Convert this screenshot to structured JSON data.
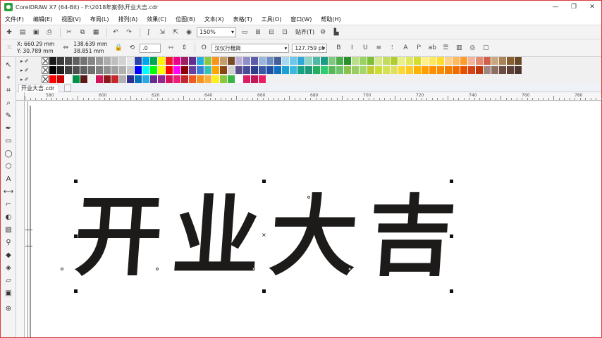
{
  "window": {
    "title": "CorelDRAW X7 (64-Bit) - F:\\2018年案例\\开业大吉.cdr",
    "controls": [
      "—",
      "❐",
      "✕"
    ]
  },
  "menu": [
    "文件(F)",
    "编辑(E)",
    "视图(V)",
    "布局(L)",
    "排列(A)",
    "效果(C)",
    "位图(B)",
    "文本(X)",
    "表格(T)",
    "工具(O)",
    "窗口(W)",
    "帮助(H)"
  ],
  "toolbar": {
    "zoom": "150%",
    "snap": "贴齐(T)"
  },
  "properties": {
    "x": "X: 660.29 mm",
    "y": "Y: 30.789 mm",
    "width": "138.639 mm",
    "height": "38.851 mm",
    "rotation": ".0",
    "font": "汉仪行楷简",
    "font_size": "127.759 pt"
  },
  "palettes": [
    [
      "#1b1b1b",
      "#3a3a3a",
      "#4d4d4d",
      "#606060",
      "#737373",
      "#868686",
      "#999999",
      "#acacac",
      "#bfbfbf",
      "#d2d2d2",
      "#e5e5e5",
      "#2c44a8",
      "#00a7e8",
      "#00a651",
      "#fff200",
      "#ed1c24",
      "#ec008c",
      "#9e1f63",
      "#662d91",
      "#29abe2",
      "#8dc63f",
      "#f7941d",
      "#c69c6d",
      "#754c24",
      "#bdb0d8",
      "#8f8fc8",
      "#5c5caa",
      "#9ab4da",
      "#6e8ec2",
      "#445f99",
      "#a8d8f0",
      "#6ec6e8",
      "#2fa8d8",
      "#8ed3c3",
      "#4fb9a7",
      "#1a9b85",
      "#7fc97f",
      "#4dad4d",
      "#2b8f2b",
      "#b8e08a",
      "#9ad25f",
      "#7bbf3a",
      "#d6e88a",
      "#c4dc5e",
      "#b0cc2e",
      "#eaf08a",
      "#e0e85e",
      "#d4dc2e",
      "#fff08a",
      "#ffe85e",
      "#ffdc2e",
      "#ffd08a",
      "#ffb85e",
      "#ff9c2e",
      "#f0b4a0",
      "#e48c74",
      "#d0604a",
      "#c8a880",
      "#a88458",
      "#886030",
      "#6a4a26"
    ],
    [
      "#000000",
      "#202020",
      "#404040",
      "#505050",
      "#606060",
      "#707070",
      "#808080",
      "#909090",
      "#a0a0a0",
      "#b0b0b0",
      "#c8c8c8",
      "#0000ff",
      "#00ffff",
      "#00ff00",
      "#ffff00",
      "#ff0000",
      "#ff00ff",
      "#8b0000",
      "#6b3fa0",
      "#3d7edb",
      "#36c2b4",
      "#ffa500",
      "#8b4513",
      "#d3d3d3",
      "#5a4e8c",
      "#4a4a9a",
      "#2c3e8c",
      "#3a5aa8",
      "#1e4fa0",
      "#0f6fc0",
      "#1ea0d0",
      "#3bb8e0",
      "#16a085",
      "#1e9a7a",
      "#27ae60",
      "#2ecc71",
      "#58b858",
      "#6ac46a",
      "#8bc34a",
      "#9ccc65",
      "#a5d66b",
      "#c0ca33",
      "#cddc39",
      "#d4e157",
      "#e0e060",
      "#fdd835",
      "#ffca28",
      "#ffb300",
      "#ffa000",
      "#ff8f00",
      "#fb8c00",
      "#f57c00",
      "#ef6c00",
      "#e65100",
      "#d84315",
      "#bf360c",
      "#a1887f",
      "#8d6e63",
      "#6d4c41",
      "#5d4037",
      "#4e342e"
    ],
    [
      "#ff0000",
      "#cc0000",
      "#ffffff",
      "#009245",
      "#5b1a1a",
      "#f2f2f2",
      "#d4145a",
      "#8c1a1a",
      "#c1272d",
      "#b0b0b0",
      "#2e3192",
      "#0071bc",
      "#29abe2",
      "#662d91",
      "#93278f",
      "#d4145a",
      "#ed1e79",
      "#c1272d",
      "#f15a24",
      "#f7931e",
      "#fbb03b",
      "#fcee21",
      "#8cc63f",
      "#39b54a",
      "#ffffff",
      "#d91e63",
      "#c2185b",
      "#e91e63"
    ]
  ],
  "document": {
    "tab": "开业大吉.cdr"
  },
  "ruler": {
    "top_labels": [
      "580",
      "600",
      "620",
      "640",
      "660",
      "680",
      "700",
      "720",
      "740",
      "760",
      "780"
    ]
  },
  "artwork": {
    "chars": [
      "开",
      "业",
      "大",
      "吉"
    ]
  }
}
